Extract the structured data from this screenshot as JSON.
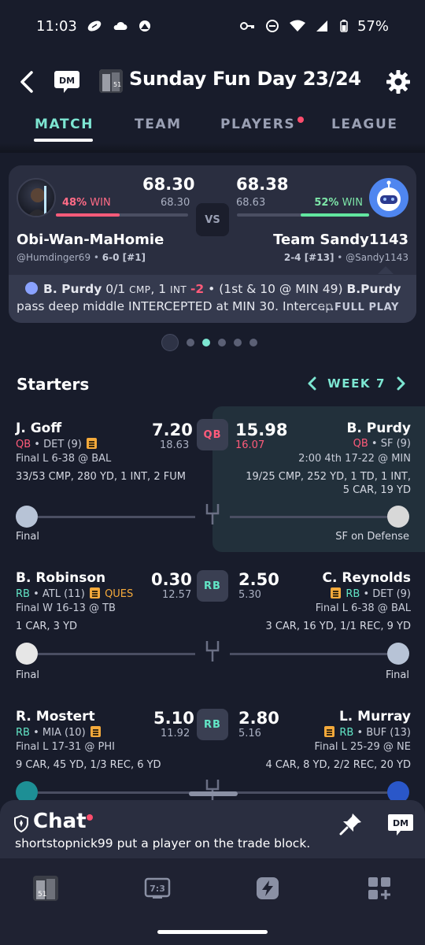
{
  "status_bar": {
    "time": "11:03",
    "battery": "57%"
  },
  "header": {
    "title": "Sunday Fun Day 23/24",
    "dm_label": "DM"
  },
  "tabs": [
    {
      "label": "MATCH",
      "active": true
    },
    {
      "label": "TEAM"
    },
    {
      "label": "PLAYERS",
      "has_dot": true
    },
    {
      "label": "LEAGUE"
    }
  ],
  "matchup": {
    "left": {
      "win_pct": "48%",
      "win_label": "WIN",
      "win_prob": 0.48,
      "score": "68.30",
      "projected": "68.30",
      "team": "Obi-Wan-MaHomie",
      "handle": "@Humdinger69",
      "record": "6-0 [#1]"
    },
    "right": {
      "win_pct": "52%",
      "win_label": "WIN",
      "win_prob": 0.52,
      "score": "68.38",
      "projected": "68.63",
      "team": "Team Sandy1143",
      "handle": "@Sandy1143",
      "record": "2-4 [#13]"
    },
    "vs_label": "VS",
    "feed": {
      "player": "B. Purdy",
      "stat": "0/1",
      "stat_unit": "CMP",
      "int_count": "1",
      "int_unit": "INT",
      "points": "-2",
      "situation": "(1st & 10 @ MIN 49)",
      "player2": "B.Purdy",
      "line2": "pass deep middle INTERCEPTED at MIN 30. Intercep",
      "full_play": "...FULL PLAY"
    }
  },
  "pager": {
    "count": 5,
    "active": 1
  },
  "starters": {
    "title": "Starters",
    "week": "WEEK 7"
  },
  "rows": [
    {
      "pos": "QB",
      "left": {
        "name": "J. Goff",
        "pos": "QB",
        "team": "DET (9)",
        "game": "Final L 6-38 @ BAL",
        "stats": "33/53 CMP, 280 YD, 1 INT, 2 FUM",
        "pts": "7.20",
        "proj": "18.63",
        "status": "Final"
      },
      "right": {
        "name": "B. Purdy",
        "pos": "QB",
        "team": "SF (9)",
        "game": "2:00 4th 17-22 @ MIN",
        "stats1": "19/25 CMP, 252 YD, 1 TD, 1 INT,",
        "stats2": "5 CAR, 19 YD",
        "pts": "15.98",
        "proj": "16.07",
        "status": "SF on Defense"
      }
    },
    {
      "pos": "RB",
      "left": {
        "name": "B. Robinson",
        "pos": "RB",
        "team": "ATL (11)",
        "tag": "QUES",
        "game": "Final W 16-13 @ TB",
        "stats": "1 CAR, 3 YD",
        "pts": "0.30",
        "proj": "12.57",
        "status": "Final"
      },
      "right": {
        "name": "C. Reynolds",
        "pos": "RB",
        "team": "DET (9)",
        "game": "Final L 6-38 @ BAL",
        "stats1": "3 CAR, 16 YD, 1/1 REC, 9 YD",
        "pts": "2.50",
        "proj": "5.30",
        "status": "Final"
      }
    },
    {
      "pos": "RB",
      "left": {
        "name": "R. Mostert",
        "pos": "RB",
        "team": "MIA (10)",
        "game": "Final L 17-31 @ PHI",
        "stats": "9 CAR, 45 YD, 1/3 REC, 6 YD",
        "pts": "5.10",
        "proj": "11.92"
      },
      "right": {
        "name": "L. Murray",
        "pos": "RB",
        "team": "BUF (13)",
        "game": "Final L 25-29 @ NE",
        "stats1": "4 CAR, 8 YD, 2/2 REC, 20 YD",
        "pts": "2.80",
        "proj": "5.16"
      }
    }
  ],
  "chat": {
    "title": "Chat",
    "message": "shortstopnick99 put a player on the trade block.",
    "dm_label": "DM"
  },
  "bottom_nav": {
    "scoreboard_label": "7:3"
  },
  "colors": {
    "accent": "#7de6d2",
    "loss": "#ff5b7a",
    "win": "#62e6a0",
    "background": "#181c2b"
  }
}
